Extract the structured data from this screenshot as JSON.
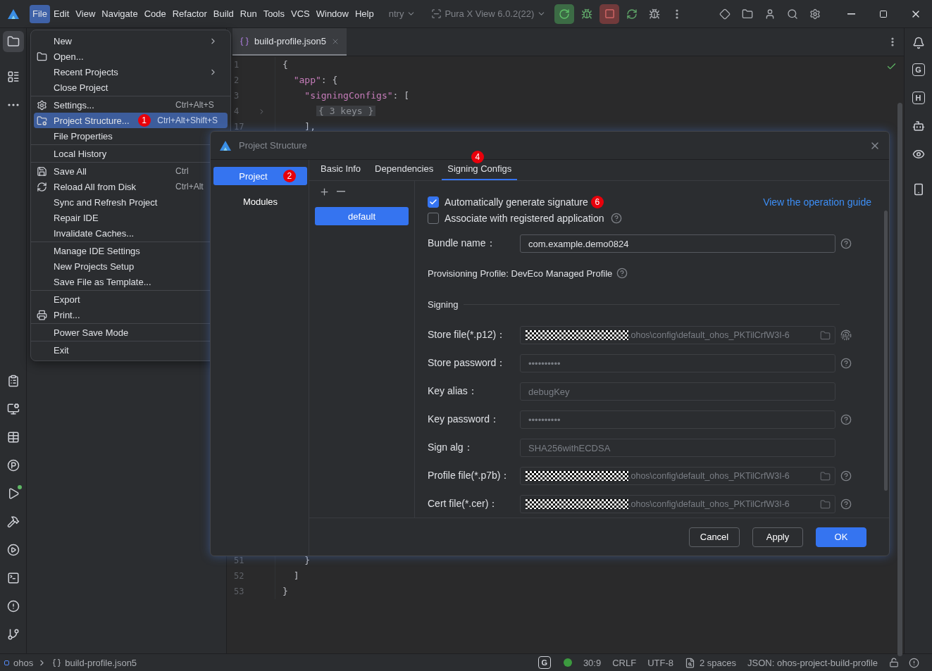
{
  "titlebar": {
    "menus": [
      {
        "label": "File",
        "selected": true
      },
      {
        "label": "Edit",
        "selected": false
      },
      {
        "label": "View",
        "selected": false
      },
      {
        "label": "Navigate",
        "selected": false
      },
      {
        "label": "Code",
        "selected": false
      },
      {
        "label": "Refactor",
        "selected": false
      },
      {
        "label": "Build",
        "selected": false
      },
      {
        "label": "Run",
        "selected": false
      },
      {
        "label": "Tools",
        "selected": false
      },
      {
        "label": "VCS",
        "selected": false
      },
      {
        "label": "Window",
        "selected": false
      },
      {
        "label": "Help",
        "selected": false
      }
    ],
    "run_config": "ntry",
    "device": "Pura X View 6.0.2(22)"
  },
  "editor": {
    "tab": {
      "label": "build-profile.json5",
      "selected": true
    },
    "lines_top": [
      {
        "number": "1",
        "text": "{",
        "folded": false
      },
      {
        "number": "2",
        "text": "  \"app\": {",
        "folded": false
      },
      {
        "number": "3",
        "text": "    \"signingConfigs\": [",
        "folded": false
      },
      {
        "number": "4",
        "text": "{ 3 keys }",
        "folded": true
      },
      {
        "number": "17",
        "text": "    ],",
        "folded": false
      }
    ],
    "lines_bottom": [
      {
        "number": "51",
        "text": "    }",
        "folded": false
      },
      {
        "number": "52",
        "text": "  ]",
        "folded": false
      },
      {
        "number": "53",
        "text": "}",
        "folded": false
      }
    ]
  },
  "file_menu": {
    "groups": [
      [
        {
          "label": "New",
          "submenu": true,
          "selected": false
        },
        {
          "label": "Open...",
          "selected": false
        },
        {
          "label": "Recent Projects",
          "submenu": true,
          "selected": false
        },
        {
          "label": "Close Project",
          "selected": false
        }
      ],
      [
        {
          "label": "Settings...",
          "shortcut": "Ctrl+Alt+S",
          "selected": false
        },
        {
          "label": "Project Structure...",
          "shortcut": "Ctrl+Alt+Shift+S",
          "selected": true,
          "badge": "1"
        },
        {
          "label": "File Properties",
          "selected": false
        }
      ],
      [
        {
          "label": "Local History",
          "selected": false
        }
      ],
      [
        {
          "label": "Save All",
          "shortcut": "Ctrl",
          "selected": false
        },
        {
          "label": "Reload All from Disk",
          "shortcut": "Ctrl+Alt",
          "selected": false
        },
        {
          "label": "Sync and Refresh Project",
          "selected": false
        },
        {
          "label": "Repair IDE",
          "selected": false
        },
        {
          "label": "Invalidate Caches...",
          "selected": false
        }
      ],
      [
        {
          "label": "Manage IDE Settings",
          "selected": false
        },
        {
          "label": "New Projects Setup",
          "selected": false
        },
        {
          "label": "Save File as Template...",
          "selected": false
        }
      ],
      [
        {
          "label": "Export",
          "selected": false
        },
        {
          "label": "Print...",
          "selected": false
        }
      ],
      [
        {
          "label": "Power Save Mode",
          "selected": false
        }
      ],
      [
        {
          "label": "Exit",
          "selected": false
        }
      ]
    ]
  },
  "dialog": {
    "title": "Project Structure",
    "nav": [
      {
        "label": "Project",
        "selected": true,
        "badge": "2"
      },
      {
        "label": "Modules",
        "selected": false
      }
    ],
    "tabs": [
      {
        "label": "Basic Info",
        "selected": false
      },
      {
        "label": "Dependencies",
        "selected": false
      },
      {
        "label": "Signing Configs",
        "selected": true,
        "badge": "4"
      }
    ],
    "configs": [
      {
        "label": "default",
        "selected": true
      }
    ],
    "rows": [
      {
        "kind": "checkbox",
        "label": "Automatically generate signature",
        "checked": true,
        "badge": "6",
        "link": "View the operation guide"
      },
      {
        "kind": "checkbox",
        "label": "Associate with registered application",
        "checked": false,
        "help": true
      },
      {
        "kind": "field",
        "label": "Bundle name：",
        "value": "com.example.demo0824",
        "disabled": false,
        "help": true
      },
      {
        "kind": "info",
        "label": "Provisioning Profile: DevEco Managed Profile",
        "help": true
      },
      {
        "kind": "section",
        "label": "Signing"
      },
      {
        "kind": "file",
        "label": "Store file(*.p12)：",
        "value": ".ohos\\config\\default_ohos_PKTilCrfW3I-6",
        "disabled": true,
        "help": false,
        "fingerprint": true
      },
      {
        "kind": "field",
        "label": "Store password：",
        "value": "••••••••••",
        "disabled": true,
        "help": true
      },
      {
        "kind": "field",
        "label": "Key alias：",
        "value": "debugKey",
        "disabled": true,
        "help": false
      },
      {
        "kind": "field",
        "label": "Key password：",
        "value": "••••••••••",
        "disabled": true,
        "help": true
      },
      {
        "kind": "field",
        "label": "Sign alg：",
        "value": "SHA256withECDSA",
        "disabled": true,
        "help": false
      },
      {
        "kind": "file",
        "label": "Profile file(*.p7b)：",
        "value": ".ohos\\config\\default_ohos_PKTilCrfW3I-6",
        "disabled": true,
        "help": true
      },
      {
        "kind": "file",
        "label": "Cert file(*.cer)：",
        "value": ".ohos\\config\\default_ohos_PKTilCrfW3I-6",
        "disabled": true,
        "help": true
      }
    ],
    "buttons": [
      {
        "label": "Cancel",
        "kind": "secondary"
      },
      {
        "label": "Apply",
        "kind": "secondary"
      },
      {
        "label": "OK",
        "kind": "primary"
      }
    ]
  },
  "right_toolbar": {
    "letters": [
      "G",
      "H"
    ]
  },
  "status_bar": {
    "breadcrumbs": [
      "ohos",
      "build-profile.json5"
    ],
    "plugin": "G",
    "position": "30:9",
    "line_ending": "CRLF",
    "encoding": "UTF-8",
    "indent": "2 spaces",
    "schema": "JSON: ohos-project-build-profile"
  }
}
